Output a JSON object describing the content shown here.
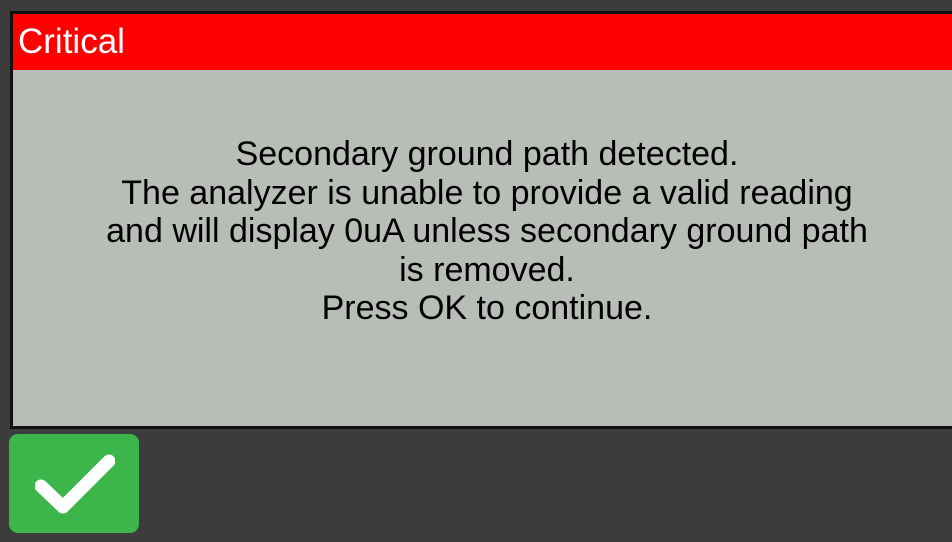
{
  "dialog": {
    "title": "Critical",
    "message_lines": [
      "Secondary ground path detected.",
      "The analyzer is unable to provide a valid reading",
      "and will display 0uA unless secondary ground path",
      "is removed.",
      "Press OK to continue."
    ]
  },
  "ok_button": {
    "icon": "checkmark-icon"
  },
  "colors": {
    "background": "#3c3c3c",
    "dialog_body": "#b9bdb8",
    "title_bar": "#fe0000",
    "ok_button": "#3cb54b"
  }
}
